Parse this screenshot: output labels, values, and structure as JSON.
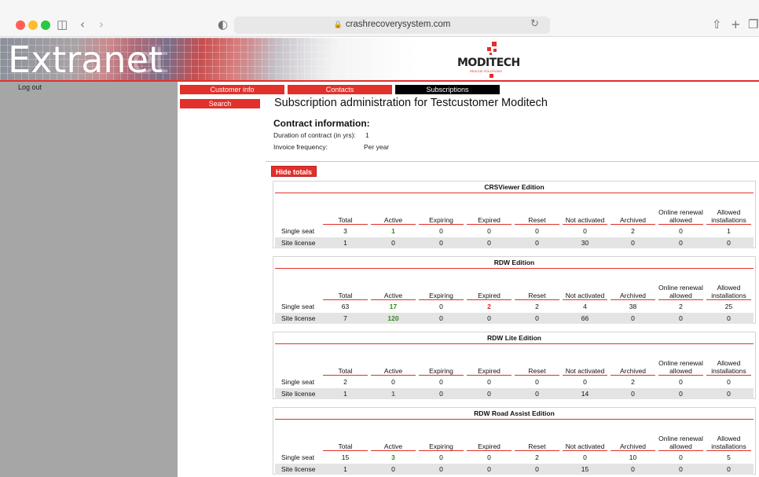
{
  "browser": {
    "url": "crashrecoverysystem.com"
  },
  "banner": {
    "title": "Extranet",
    "logo_text": "MODITECH",
    "logo_tagline": "RESCUE SOLUTIONS"
  },
  "sidebar": {
    "logout": "Log out"
  },
  "nav": {
    "customer_info": "Customer info",
    "contacts": "Contacts",
    "subscriptions": "Subscriptions",
    "search": "Search"
  },
  "page": {
    "title": "Subscription administration for Testcustomer Moditech",
    "contract_heading": "Contract information:",
    "duration_label": "Duration of contract (in yrs):",
    "duration_value": "1",
    "invoice_label": "Invoice frequency:",
    "invoice_value": "Per year",
    "hide_totals": "Hide totals"
  },
  "columns": [
    "Total",
    "Active",
    "Expiring",
    "Expired",
    "Reset",
    "Not activated",
    "Archived",
    "Online renewal allowed",
    "Allowed installations"
  ],
  "editions": [
    {
      "title": "CRSViewer Edition",
      "rows": [
        {
          "label": "Single seat",
          "values": [
            "3",
            "1",
            "0",
            "0",
            "0",
            "0",
            "2",
            "0",
            "1"
          ],
          "highlight": {
            "1": "green"
          }
        },
        {
          "label": "Site license",
          "values": [
            "1",
            "0",
            "0",
            "0",
            "0",
            "30",
            "0",
            "0",
            "0"
          ],
          "highlight": {}
        }
      ]
    },
    {
      "title": "RDW Edition",
      "rows": [
        {
          "label": "Single seat",
          "values": [
            "63",
            "17",
            "0",
            "2",
            "2",
            "4",
            "38",
            "2",
            "25"
          ],
          "highlight": {
            "1": "green",
            "3": "red"
          }
        },
        {
          "label": "Site license",
          "values": [
            "7",
            "120",
            "0",
            "0",
            "0",
            "66",
            "0",
            "0",
            "0"
          ],
          "highlight": {
            "1": "green"
          }
        }
      ]
    },
    {
      "title": "RDW Lite Edition",
      "rows": [
        {
          "label": "Single seat",
          "values": [
            "2",
            "0",
            "0",
            "0",
            "0",
            "0",
            "2",
            "0",
            "0"
          ],
          "highlight": {}
        },
        {
          "label": "Site license",
          "values": [
            "1",
            "1",
            "0",
            "0",
            "0",
            "14",
            "0",
            "0",
            "0"
          ],
          "highlight": {
            "1": "green"
          }
        }
      ]
    },
    {
      "title": "RDW Road Assist Edition",
      "rows": [
        {
          "label": "Single seat",
          "values": [
            "15",
            "3",
            "0",
            "0",
            "2",
            "0",
            "10",
            "0",
            "5"
          ],
          "highlight": {
            "1": "green"
          }
        },
        {
          "label": "Site license",
          "values": [
            "1",
            "0",
            "0",
            "0",
            "0",
            "15",
            "0",
            "0",
            "0"
          ],
          "highlight": {}
        }
      ]
    }
  ],
  "colors": {
    "accent": "#e2302a",
    "active_value": "#2e8b1e",
    "expired_value": "#d8261f"
  }
}
